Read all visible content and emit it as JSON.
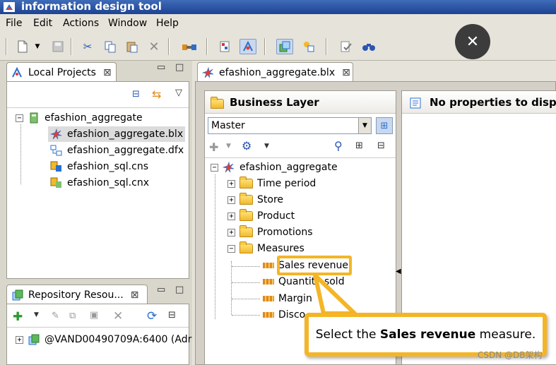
{
  "window": {
    "title": "information design tool"
  },
  "menu": [
    "File",
    "Edit",
    "Actions",
    "Window",
    "Help"
  ],
  "toolbar_icons": [
    "new-icon",
    "dropdown-icon",
    "save-icon",
    "cut-icon",
    "copy-icon",
    "paste-icon",
    "delete-icon",
    "connection-icon",
    "data-foundation-icon",
    "business-layer-icon",
    "project-sync-icon",
    "repository-icon",
    "check-integrity-icon",
    "find-icon"
  ],
  "local_projects": {
    "tab_label": "Local Projects",
    "root": "efashion_aggregate",
    "items": [
      "efashion_aggregate.blx",
      "efashion_aggregate.dfx",
      "efashion_sql.cns",
      "efashion_sql.cnx"
    ],
    "selected_index": 0
  },
  "repository": {
    "tab_label": "Repository Resou...",
    "session": "@VAND00490709A:6400 (Adr"
  },
  "editor_tab": {
    "label": "efashion_aggregate.blx"
  },
  "business_layer": {
    "title": "Business Layer",
    "view_select": "Master",
    "root": "efashion_aggregate",
    "folders": [
      "Time period",
      "Store",
      "Product",
      "Promotions",
      "Measures"
    ],
    "measures": [
      "Sales revenue",
      "Quantity sold",
      "Margin",
      "Disco"
    ]
  },
  "properties": {
    "message": "No properties to display"
  },
  "callout": {
    "prefix": "Select the ",
    "bold": "Sales revenue",
    "suffix": " measure."
  },
  "watermark": "CSDN @DB架构",
  "colors": {
    "title_bar": "#1d4393",
    "highlight": "#f4b526",
    "fab": "#3c3c3c"
  }
}
